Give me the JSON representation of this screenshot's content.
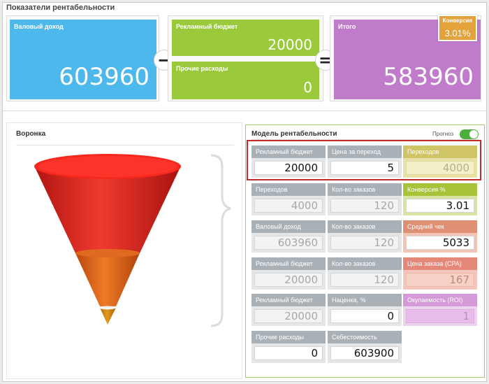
{
  "header": {
    "title": "Показатели рентабельности"
  },
  "kpis": {
    "gross": {
      "label": "Валовый доход",
      "value": "603960",
      "color": "#4db8ec"
    },
    "ad_budget": {
      "label": "Рекламный бюджет",
      "value": "20000",
      "color": "#9bc93c"
    },
    "other_costs": {
      "label": "Прочие расходы",
      "value": "0",
      "color": "#9bc93c"
    },
    "total": {
      "label": "Итого",
      "value": "583960",
      "color": "#c07ccb"
    },
    "conversion": {
      "label": "Конверсия",
      "value": "3.01%",
      "color": "#e4a23c"
    }
  },
  "operators": {
    "minus": "−",
    "equals": "="
  },
  "funnel": {
    "title": "Воронка"
  },
  "model": {
    "title": "Модель рентабельности",
    "forecast_label": "Прогноз",
    "forecast_on": true,
    "rows": [
      [
        {
          "label": "Рекламный бюджет",
          "value": "20000"
        },
        {
          "label": "Цена за переход",
          "value": "5"
        },
        {
          "label": "Переходов",
          "value": "4000"
        }
      ],
      [
        {
          "label": "Переходов",
          "value": "4000"
        },
        {
          "label": "Кол-во заказов",
          "value": "120"
        },
        {
          "label": "Конверсия %",
          "value": "3.01"
        }
      ],
      [
        {
          "label": "Валовый доход",
          "value": "603960"
        },
        {
          "label": "Кол-во заказов",
          "value": "120"
        },
        {
          "label": "Средний чек",
          "value": "5033"
        }
      ],
      [
        {
          "label": "Рекламный бюджет",
          "value": "20000"
        },
        {
          "label": "Кол-во заказов",
          "value": "120"
        },
        {
          "label": "Цена заказа (CPA)",
          "value": "167"
        }
      ],
      [
        {
          "label": "Рекламный бюджет",
          "value": "20000"
        },
        {
          "label": "Наценка, %",
          "value": "0"
        },
        {
          "label": "Окупаемость (ROI)",
          "value": "1"
        }
      ],
      [
        {
          "label": "Прочие расходы",
          "value": "0"
        },
        {
          "label": "Себестоимость",
          "value": "603900"
        }
      ]
    ]
  },
  "colors": {
    "funnel_top": "#e8241e",
    "funnel_mid": "#d9661a",
    "funnel_bottom": "#c97d14",
    "model_border": "#9ccd6a",
    "highlight": "#c42b2b"
  }
}
